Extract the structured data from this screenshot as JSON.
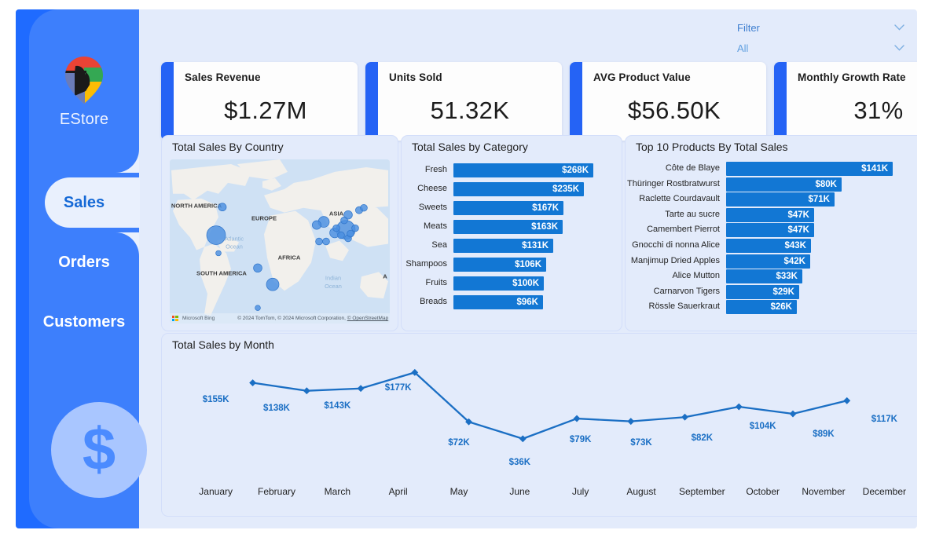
{
  "brand": {
    "name": "EStore",
    "logo_icon": "location-pin-logo-icon"
  },
  "sidebar": {
    "items": [
      {
        "label": "Sales",
        "active": true
      },
      {
        "label": "Orders",
        "active": false
      },
      {
        "label": "Customers",
        "active": false
      }
    ],
    "coin_icon": "dollar-sign-icon",
    "coin_glyph": "$"
  },
  "filter": {
    "label": "Filter",
    "value": "All",
    "chevron_icon": "chevron-down-icon"
  },
  "kpis": [
    {
      "title": "Sales Revenue",
      "value": "$1.27M"
    },
    {
      "title": "Units Sold",
      "value": "51.32K"
    },
    {
      "title": "AVG Product Value",
      "value": "$56.50K"
    },
    {
      "title": "Monthly Growth Rate",
      "value": "31%"
    }
  ],
  "map_card": {
    "title": "Total Sales By Country",
    "provider": "Microsoft Bing",
    "attribution": "© 2024 TomTom, © 2024 Microsoft Corporation,",
    "attribution_link": "© OpenStreetMap",
    "region_labels": [
      "NORTH AMERICA",
      "SOUTH AMERICA",
      "EUROPE",
      "ASIA",
      "AFRICA",
      "Atlantic Ocean",
      "Indian Ocean"
    ]
  },
  "accent_colors": {
    "brand_blue": "#2563f5",
    "sidebar_blue": "#3d7ffc",
    "panel_blue": "#e3ebfb",
    "bar_blue": "#1277d4",
    "line_blue": "#1b6fc4",
    "card_white": "#fdfdfd"
  },
  "chart_data": [
    {
      "type": "bar",
      "title": "Total Sales by Category",
      "orientation": "horizontal",
      "categories": [
        "Fresh",
        "Cheese",
        "Sweets",
        "Meats",
        "Sea",
        "Shampoos",
        "Fruits",
        "Breads"
      ],
      "values": [
        268,
        235,
        167,
        163,
        131,
        106,
        100,
        96
      ],
      "labels": [
        "$268K",
        "$235K",
        "$167K",
        "$163K",
        "$131K",
        "$106K",
        "$100K",
        "$96K"
      ],
      "unit": "K USD",
      "xlabel": "",
      "ylabel": "",
      "grid": false,
      "legend": false,
      "xlim": [
        0,
        268
      ]
    },
    {
      "type": "bar",
      "title": "Top 10 Products By Total Sales",
      "orientation": "horizontal",
      "categories": [
        "Côte de Blaye",
        "Thüringer Rostbratwurst",
        "Raclette Courdavault",
        "Tarte au sucre",
        "Camembert Pierrot",
        "Gnocchi di nonna Alice",
        "Manjimup Dried Apples",
        "Alice Mutton",
        "Carnarvon Tigers",
        "Rössle Sauerkraut"
      ],
      "values": [
        141,
        80,
        71,
        47,
        47,
        43,
        42,
        33,
        29,
        26
      ],
      "labels": [
        "$141K",
        "$80K",
        "$71K",
        "$47K",
        "$47K",
        "$43K",
        "$42K",
        "$33K",
        "$29K",
        "$26K"
      ],
      "unit": "K USD",
      "xlabel": "",
      "ylabel": "",
      "grid": false,
      "legend": false,
      "xlim": [
        0,
        141
      ]
    },
    {
      "type": "line",
      "title": "Total Sales by Month",
      "categories": [
        "January",
        "February",
        "March",
        "April",
        "May",
        "June",
        "July",
        "August",
        "September",
        "October",
        "November",
        "December"
      ],
      "values": [
        155,
        138,
        143,
        177,
        72,
        36,
        79,
        73,
        82,
        104,
        89,
        117
      ],
      "labels": [
        "$155K",
        "$138K",
        "$143K",
        "$177K",
        "$72K",
        "$36K",
        "$79K",
        "$73K",
        "$82K",
        "$104K",
        "$89K",
        "$117K"
      ],
      "unit": "K USD",
      "xlabel": "",
      "ylabel": "",
      "grid": false,
      "legend": false,
      "marker": "diamond",
      "ylim": [
        0,
        190
      ]
    },
    {
      "type": "map",
      "title": "Total Sales By Country",
      "description": "World bubble map with sales bubbles sized by total sales",
      "bubbles": [
        {
          "region": "United States",
          "x": 21,
          "y": 46,
          "size": 13
        },
        {
          "region": "Canada",
          "x": 24,
          "y": 29,
          "size": 6
        },
        {
          "region": "Mexico",
          "x": 22,
          "y": 57,
          "size": 4
        },
        {
          "region": "Venezuela",
          "x": 40,
          "y": 66,
          "size": 6
        },
        {
          "region": "Brazil",
          "x": 47,
          "y": 76,
          "size": 9
        },
        {
          "region": "Argentina",
          "x": 40,
          "y": 90,
          "size": 4
        },
        {
          "region": "UK",
          "x": 70,
          "y": 38,
          "size": 8
        },
        {
          "region": "Ireland",
          "x": 67,
          "y": 40,
          "size": 6
        },
        {
          "region": "Germany",
          "x": 80,
          "y": 43,
          "size": 13
        },
        {
          "region": "France",
          "x": 75,
          "y": 45,
          "size": 7
        },
        {
          "region": "Spain",
          "x": 71,
          "y": 50,
          "size": 5
        },
        {
          "region": "Portugal",
          "x": 68,
          "y": 50,
          "size": 5
        },
        {
          "region": "Italy",
          "x": 81,
          "y": 48,
          "size": 5
        },
        {
          "region": "Poland",
          "x": 84,
          "y": 40,
          "size": 5
        },
        {
          "region": "Sweden",
          "x": 86,
          "y": 31,
          "size": 5
        },
        {
          "region": "Norway",
          "x": 81,
          "y": 34,
          "size": 6
        },
        {
          "region": "Denmark",
          "x": 79,
          "y": 37,
          "size": 5
        },
        {
          "region": "Austria",
          "x": 82,
          "y": 45,
          "size": 5
        },
        {
          "region": "Switzerland",
          "x": 78,
          "y": 46,
          "size": 5
        },
        {
          "region": "Belgium",
          "x": 76,
          "y": 42,
          "size": 5
        },
        {
          "region": "Finland",
          "x": 88,
          "y": 29,
          "size": 5
        }
      ]
    }
  ]
}
